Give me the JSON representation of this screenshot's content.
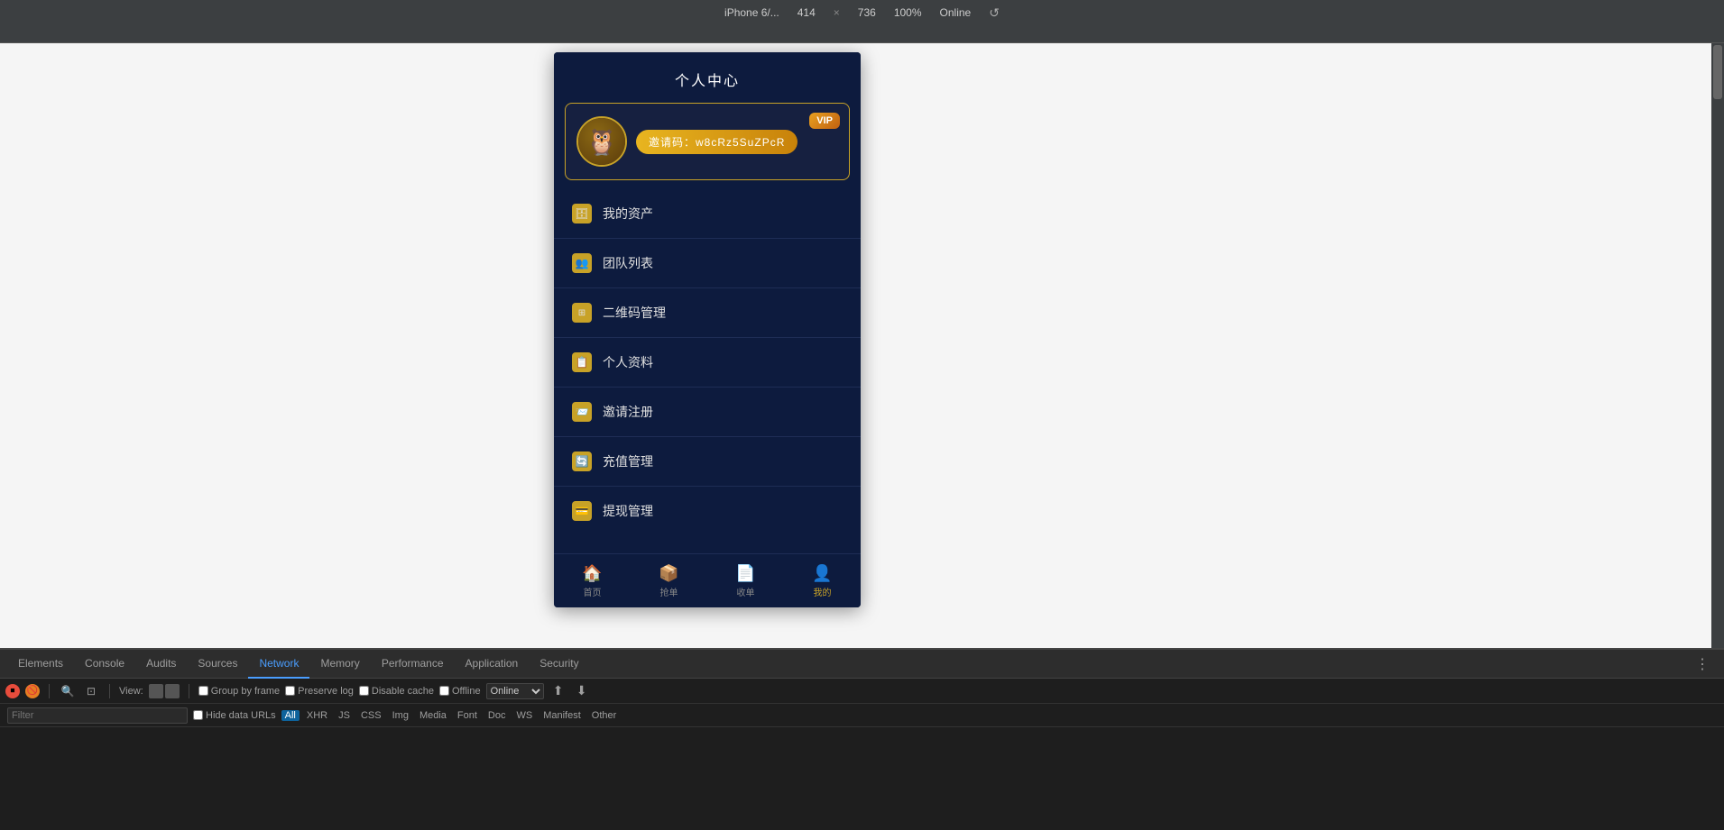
{
  "topbar": {
    "device_name": "iPhone 6/...",
    "width": "414",
    "x": "×",
    "height": "736",
    "zoom": "100%",
    "online": "Online",
    "reload_icon": "↺"
  },
  "app": {
    "title": "个人中心",
    "invite_code_label": "邀请码：w8cRz5SuZPcR",
    "vip_label": "VIP",
    "avatar_emoji": "🦉",
    "menu_items": [
      {
        "id": "assets",
        "icon": "🗄",
        "label": "我的资产"
      },
      {
        "id": "team",
        "icon": "👥",
        "label": "团队列表"
      },
      {
        "id": "qr",
        "icon": "⊞",
        "label": "二维码管理"
      },
      {
        "id": "profile",
        "icon": "📋",
        "label": "个人资料"
      },
      {
        "id": "invite",
        "icon": "📨",
        "label": "邀请注册"
      },
      {
        "id": "recharge",
        "icon": "🔄",
        "label": "充值管理"
      },
      {
        "id": "withdraw",
        "icon": "💳",
        "label": "提现管理"
      }
    ],
    "bottom_nav": [
      {
        "id": "home",
        "icon": "🏠",
        "label": "首页",
        "active": false
      },
      {
        "id": "grab",
        "icon": "📦",
        "label": "抢单",
        "active": false
      },
      {
        "id": "orders",
        "icon": "📄",
        "label": "收单",
        "active": false
      },
      {
        "id": "mine",
        "icon": "👤",
        "label": "我的",
        "active": true
      }
    ]
  },
  "devtools": {
    "tabs": [
      {
        "id": "elements",
        "label": "Elements",
        "active": false
      },
      {
        "id": "console",
        "label": "Console",
        "active": false
      },
      {
        "id": "audits",
        "label": "Audits",
        "active": false
      },
      {
        "id": "sources",
        "label": "Sources",
        "active": false
      },
      {
        "id": "network",
        "label": "Network",
        "active": true
      },
      {
        "id": "memory",
        "label": "Memory",
        "active": false
      },
      {
        "id": "performance",
        "label": "Performance",
        "active": false
      },
      {
        "id": "application",
        "label": "Application",
        "active": false
      },
      {
        "id": "security",
        "label": "Security",
        "active": false
      }
    ],
    "toolbar": {
      "view_label": "View:",
      "group_by_frame_label": "Group by frame",
      "preserve_log_label": "Preserve log",
      "disable_cache_label": "Disable cache",
      "offline_label": "Offline",
      "online_label": "Online"
    },
    "filter": {
      "placeholder": "Filter",
      "hide_urls_label": "Hide data URLs",
      "tags": [
        "All",
        "XHR",
        "JS",
        "CSS",
        "Img",
        "Media",
        "Font",
        "Doc",
        "WS",
        "Manifest",
        "Other"
      ]
    }
  }
}
